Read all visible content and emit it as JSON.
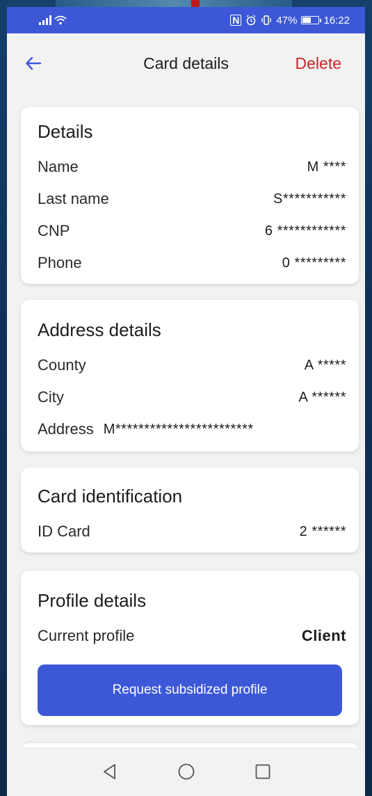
{
  "status_bar": {
    "time": "16:22",
    "battery_text": "47%",
    "battery_level": 0.47
  },
  "header": {
    "title": "Card details",
    "delete_label": "Delete"
  },
  "details": {
    "title": "Details",
    "rows": [
      {
        "label": "Name",
        "value": "M ****"
      },
      {
        "label": "Last name",
        "value": "S***********"
      },
      {
        "label": "CNP",
        "value": "6 ************"
      },
      {
        "label": "Phone",
        "value": "0 *********"
      }
    ]
  },
  "address_details": {
    "title": "Address details",
    "rows": [
      {
        "label": "County",
        "value": "A *****"
      },
      {
        "label": "City",
        "value": "A ******"
      },
      {
        "label": "Address",
        "value": "M************************"
      }
    ]
  },
  "card_identification": {
    "title": "Card identification",
    "rows": [
      {
        "label": "ID Card",
        "value": "2 ******"
      }
    ]
  },
  "profile_details": {
    "title": "Profile details",
    "current_profile_label": "Current profile",
    "current_profile_value": "Client",
    "request_button_label": "Request subsidized profile"
  },
  "colors": {
    "primary": "#3c58d7",
    "danger": "#c62828",
    "background": "#f2f2f2"
  }
}
